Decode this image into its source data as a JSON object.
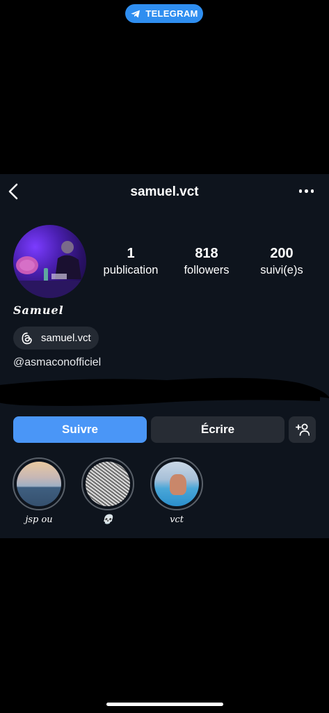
{
  "app": {
    "source_badge": "TELEGRAM"
  },
  "profile": {
    "username": "samuel.vct",
    "display_name": "Samuel",
    "threads_handle": "samuel.vct",
    "bio_mention": "@asmaconofficiel",
    "stats": [
      {
        "value": "1",
        "label": "publication"
      },
      {
        "value": "818",
        "label": "followers"
      },
      {
        "value": "200",
        "label": "suivi(e)s"
      }
    ]
  },
  "actions": {
    "follow_label": "Suivre",
    "message_label": "Écrire"
  },
  "highlights": [
    {
      "label": "jsp ou",
      "cover": "sunset-sea"
    },
    {
      "label": "💀",
      "cover": "gray-noise"
    },
    {
      "label": "vct",
      "cover": "pool-person"
    }
  ],
  "colors": {
    "background": "#000000",
    "panel": "#0e141d",
    "primary_button": "#4a96f7",
    "secondary_button": "#272c34",
    "telegram_blue": "#2f8ef0"
  },
  "icons": {
    "back": "chevron-left-icon",
    "more": "more-horizontal-icon",
    "threads": "threads-icon",
    "add_user": "add-user-icon",
    "telegram": "telegram-plane-icon"
  }
}
